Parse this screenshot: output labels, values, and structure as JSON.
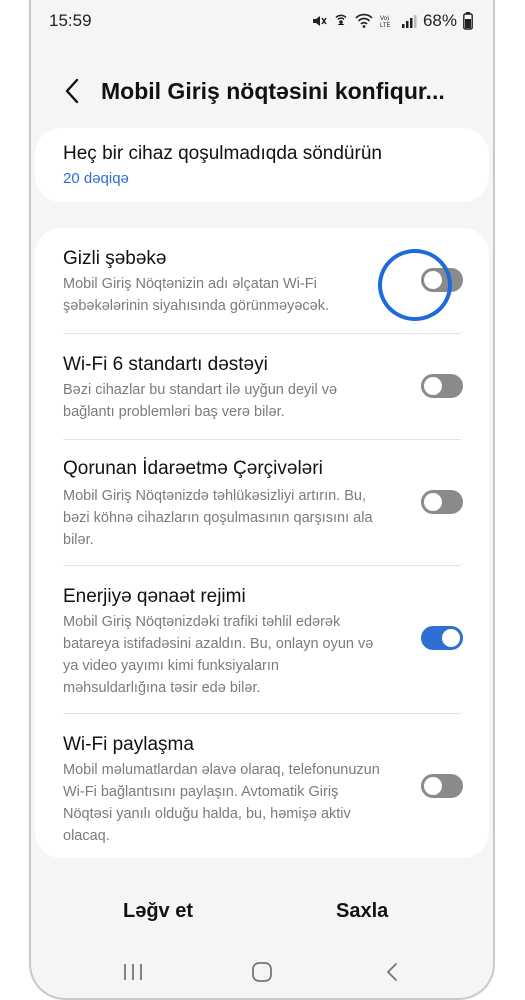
{
  "status_bar": {
    "time": "15:59",
    "battery": "68%",
    "icons": [
      "mute-icon",
      "hotspot-icon",
      "wifi-icon",
      "volte-icon",
      "signal-icon",
      "battery-icon"
    ]
  },
  "header": {
    "title": "Mobil Giriş nöqtəsini konfiqur..."
  },
  "timeout": {
    "title": "Heç bir cihaz qoşulmadıqda söndürün",
    "value": "20 dəqiqə"
  },
  "settings": [
    {
      "title": "Gizli şəbəkə",
      "desc": "Mobil Giriş Nöqtənizin adı əlçatan Wi-Fi şəbəkələrinin siyahısında görünməyəcək.",
      "enabled": false,
      "highlighted": true
    },
    {
      "title": "Wi-Fi 6 standartı dəstəyi",
      "desc": "Bəzi cihazlar bu standart ilə uyğun deyil və bağlantı problemləri baş verə bilər.",
      "enabled": false
    },
    {
      "title": "Qorunan İdarəetmə Çərçivələri",
      "desc": "Mobil Giriş Nöqtənizdə təhlükəsizliyi artırın. Bu, bəzi köhnə cihazların qoşulmasının qarşısını ala bilər.",
      "enabled": false
    },
    {
      "title": "Enerjiyə qənaət rejimi",
      "desc": "Mobil Giriş Nöqtənizdəki trafiki təhlil edərək batareya istifadəsini azaldın. Bu, onlayn oyun və ya video yayımı kimi funksiyaların məhsuldarlığına təsir edə bilər.",
      "enabled": true
    },
    {
      "title": "Wi-Fi paylaşma",
      "desc": "Mobil məlumatlardan əlavə olaraq, telefonunuzun Wi-Fi bağlantısını paylaşın. Avtomatik Giriş Nöqtəsi yanılı olduğu halda, bu, həmişə aktiv olacaq.",
      "enabled": false
    }
  ],
  "actions": {
    "cancel": "Ləğv et",
    "save": "Saxla"
  },
  "colors": {
    "accent": "#2f6fd3",
    "highlight": "#1e6ad9",
    "toggle_off": "#8a8a8a",
    "background": "#f5f5f7"
  }
}
